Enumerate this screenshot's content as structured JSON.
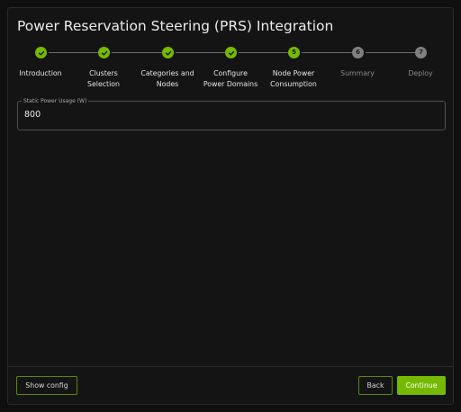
{
  "dialog": {
    "title": "Power Reservation Steering (PRS) Integration"
  },
  "stepper": {
    "steps": [
      {
        "number": "1",
        "label": "Introduction",
        "state": "done"
      },
      {
        "number": "2",
        "label": "Clusters\nSelection",
        "state": "done"
      },
      {
        "number": "3",
        "label": "Categories and\nNodes",
        "state": "done"
      },
      {
        "number": "4",
        "label": "Configure\nPower Domains",
        "state": "done"
      },
      {
        "number": "5",
        "label": "Node Power\nConsumption",
        "state": "active"
      },
      {
        "number": "6",
        "label": "Summary",
        "state": "todo"
      },
      {
        "number": "7",
        "label": "Deploy",
        "state": "todo"
      }
    ]
  },
  "form": {
    "static_power": {
      "label": "Static Power Usage (W)",
      "value": "800"
    }
  },
  "footer": {
    "show_config_label": "Show config",
    "back_label": "Back",
    "continue_label": "Continue"
  },
  "colors": {
    "accent": "#76b900",
    "inactive_step": "#808080"
  }
}
